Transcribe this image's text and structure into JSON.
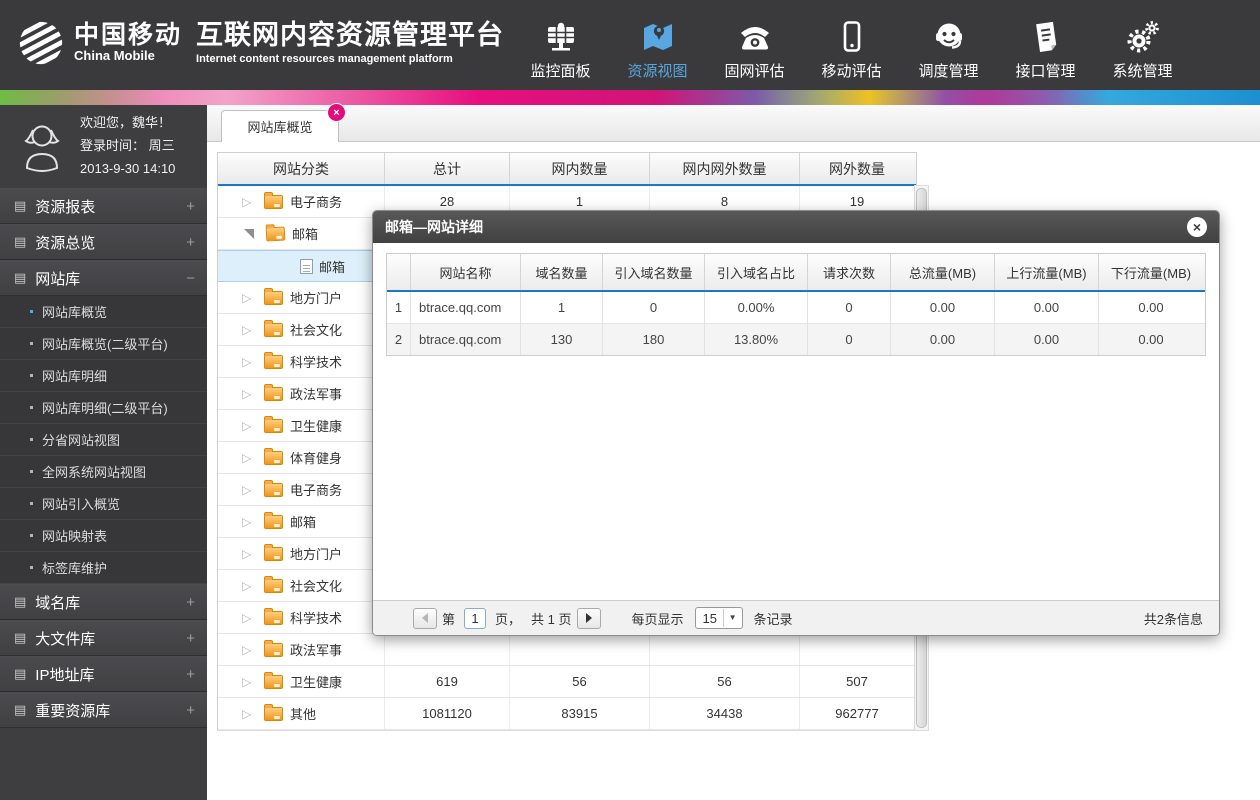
{
  "colors": {
    "accent_blue": "#1b79c0",
    "nav_active": "#58a7e0",
    "badge_pink": "#e40b7d"
  },
  "header": {
    "logo_zh": "中国移动",
    "logo_en": "China Mobile",
    "title_zh": "互联网内容资源管理平台",
    "title_en": "Internet content resources management platform",
    "nav": [
      {
        "label": "监控面板",
        "icon": "dashboard-icon",
        "active": false
      },
      {
        "label": "资源视图",
        "icon": "map-icon",
        "active": true
      },
      {
        "label": "固网评估",
        "icon": "telephone-icon",
        "active": false
      },
      {
        "label": "移动评估",
        "icon": "mobile-phone-icon",
        "active": false
      },
      {
        "label": "调度管理",
        "icon": "operator-headset-icon",
        "active": false
      },
      {
        "label": "接口管理",
        "icon": "document-icon",
        "active": false
      },
      {
        "label": "系统管理",
        "icon": "gears-icon",
        "active": false
      }
    ]
  },
  "sidebar": {
    "welcome_line1": "欢迎您，魏华！",
    "welcome_line2": "登录时间： 周三",
    "welcome_line3": "2013-9-30  14:10",
    "groups": [
      {
        "label": "资源报表",
        "expander": "+",
        "children": []
      },
      {
        "label": "资源总览",
        "expander": "+",
        "children": []
      },
      {
        "label": "网站库",
        "expander": "−",
        "children": [
          {
            "label": "网站库概览",
            "active": true
          },
          {
            "label": "网站库概览(二级平台)",
            "active": false
          },
          {
            "label": "网站库明细",
            "active": false
          },
          {
            "label": "网站库明细(二级平台)",
            "active": false
          },
          {
            "label": "分省网站视图",
            "active": false
          },
          {
            "label": "全网系统网站视图",
            "active": false
          },
          {
            "label": "网站引入概览",
            "active": false
          },
          {
            "label": "网站映射表",
            "active": false
          },
          {
            "label": "标签库维护",
            "active": false
          }
        ]
      },
      {
        "label": "域名库",
        "expander": "+",
        "children": []
      },
      {
        "label": "大文件库",
        "expander": "+",
        "children": []
      },
      {
        "label": "IP地址库",
        "expander": "+",
        "children": []
      },
      {
        "label": "重要资源库",
        "expander": "+",
        "children": []
      }
    ]
  },
  "tab": {
    "label": "网站库概览",
    "close": "×"
  },
  "main_table": {
    "headers": [
      "网站分类",
      "总计",
      "网内数量",
      "网内网外数量",
      "网外数量"
    ],
    "rows": [
      {
        "label": "电子商务",
        "level": 0,
        "state": "collapsed",
        "selected": false,
        "values": [
          "28",
          "1",
          "8",
          "19"
        ]
      },
      {
        "label": "邮箱",
        "level": 0,
        "state": "expanded",
        "selected": false,
        "values": [
          "",
          "",
          "",
          ""
        ]
      },
      {
        "label": "邮箱",
        "level": 1,
        "state": "leaf",
        "selected": true,
        "values": [
          "",
          "",
          "",
          ""
        ]
      },
      {
        "label": "地方门户",
        "level": 0,
        "state": "collapsed",
        "selected": false,
        "values": [
          "",
          "",
          "",
          ""
        ]
      },
      {
        "label": "社会文化",
        "level": 0,
        "state": "collapsed",
        "selected": false,
        "values": [
          "",
          "",
          "",
          ""
        ]
      },
      {
        "label": "科学技术",
        "level": 0,
        "state": "collapsed",
        "selected": false,
        "values": [
          "",
          "",
          "",
          ""
        ]
      },
      {
        "label": "政法军事",
        "level": 0,
        "state": "collapsed",
        "selected": false,
        "values": [
          "",
          "",
          "",
          ""
        ]
      },
      {
        "label": "卫生健康",
        "level": 0,
        "state": "collapsed",
        "selected": false,
        "values": [
          "",
          "",
          "",
          ""
        ]
      },
      {
        "label": "体育健身",
        "level": 0,
        "state": "collapsed",
        "selected": false,
        "values": [
          "",
          "",
          "",
          ""
        ]
      },
      {
        "label": "电子商务",
        "level": 0,
        "state": "collapsed",
        "selected": false,
        "values": [
          "",
          "",
          "",
          ""
        ]
      },
      {
        "label": "邮箱",
        "level": 0,
        "state": "collapsed",
        "selected": false,
        "values": [
          "",
          "",
          "",
          ""
        ]
      },
      {
        "label": "地方门户",
        "level": 0,
        "state": "collapsed",
        "selected": false,
        "values": [
          "",
          "",
          "",
          ""
        ]
      },
      {
        "label": "社会文化",
        "level": 0,
        "state": "collapsed",
        "selected": false,
        "values": [
          "",
          "",
          "",
          ""
        ]
      },
      {
        "label": "科学技术",
        "level": 0,
        "state": "collapsed",
        "selected": false,
        "values": [
          "",
          "",
          "",
          ""
        ]
      },
      {
        "label": "政法军事",
        "level": 0,
        "state": "collapsed",
        "selected": false,
        "values": [
          "",
          "",
          "",
          ""
        ]
      },
      {
        "label": "卫生健康",
        "level": 0,
        "state": "collapsed",
        "selected": false,
        "values": [
          "619",
          "56",
          "56",
          "507"
        ]
      },
      {
        "label": "其他",
        "level": 0,
        "state": "collapsed",
        "selected": false,
        "values": [
          "1081120",
          "83915",
          "34438",
          "962777"
        ]
      }
    ]
  },
  "modal": {
    "title": "邮箱—网站详细",
    "close": "×",
    "table": {
      "headers": [
        "",
        "网站名称",
        "域名数量",
        "引入域名数量",
        "引入域名占比",
        "请求次数",
        "总流量(MB)",
        "上行流量(MB)",
        "下行流量(MB)"
      ],
      "rows": [
        [
          "1",
          "btrace.qq.com",
          "1",
          "0",
          "0.00%",
          "0",
          "0.00",
          "0.00",
          "0.00"
        ],
        [
          "2",
          "btrace.qq.com",
          "130",
          "180",
          "13.80%",
          "0",
          "0.00",
          "0.00",
          "0.00"
        ]
      ]
    },
    "pagination": {
      "page_prefix": "第",
      "page_value": "1",
      "page_suffix": "页，",
      "total_pages": "共 1 页",
      "per_page_label": "每页显示",
      "per_page_value": "15",
      "per_page_suffix": "条记录",
      "total_info": "共2条信息"
    }
  }
}
